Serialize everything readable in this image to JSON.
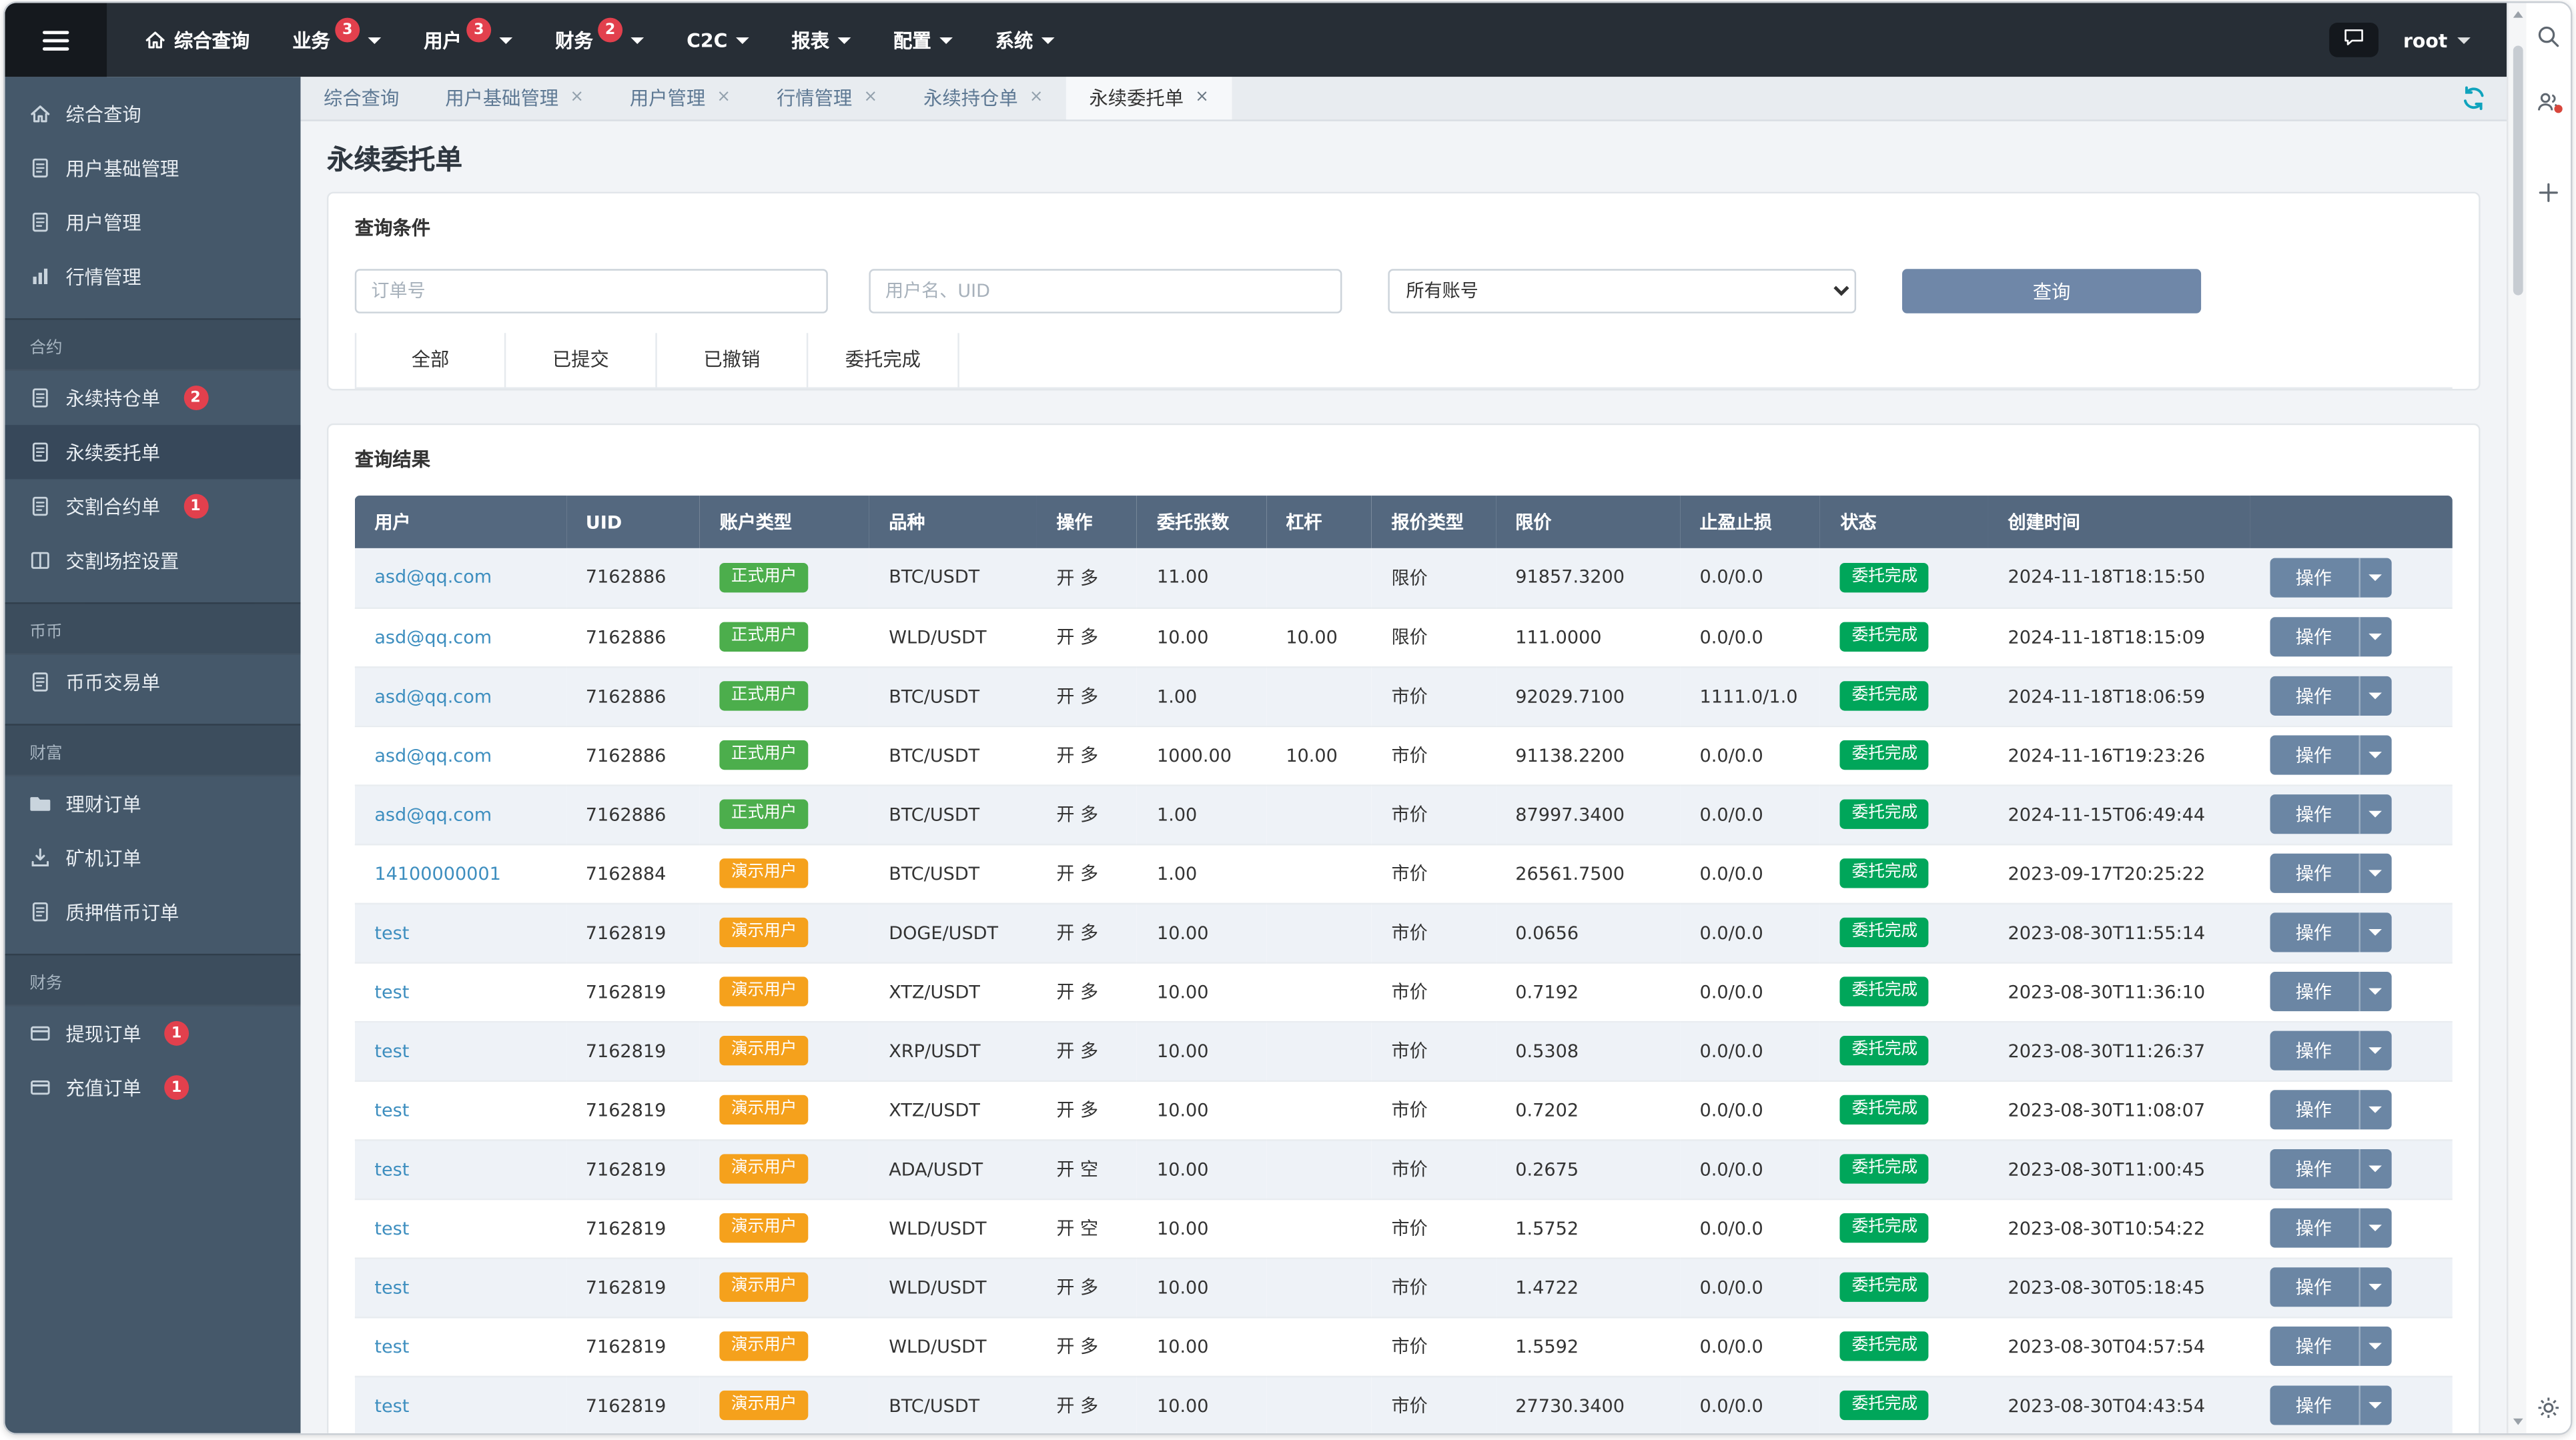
{
  "colors": {
    "navbar_bg": "#272e36",
    "sidebar_bg": "#45586a",
    "sidebar_active_bg": "#37485a",
    "accent_red_badge": "#e2404d",
    "search_button_bg": "#6f87a8",
    "table_header_bg": "#54687f",
    "account_formal_green": "#4cae4c",
    "account_demo_orange": "#f5a11c",
    "status_complete_green": "#00a65a",
    "link_blue": "#3d8ebf",
    "refresh_teal": "#0fa3bd",
    "row_stripe": "#eef2f7"
  },
  "icons": {
    "close": "×",
    "caret": "▾"
  },
  "navbar": {
    "items": [
      {
        "name": "overview",
        "label": "综合查询",
        "icon": "home",
        "badge": "",
        "caret": false
      },
      {
        "name": "business",
        "label": "业务",
        "icon": "",
        "badge": "3",
        "caret": true
      },
      {
        "name": "users",
        "label": "用户",
        "icon": "",
        "badge": "3",
        "caret": true
      },
      {
        "name": "finance",
        "label": "财务",
        "icon": "",
        "badge": "2",
        "caret": true
      },
      {
        "name": "c2c",
        "label": "C2C",
        "icon": "",
        "badge": "",
        "caret": true
      },
      {
        "name": "reports",
        "label": "报表",
        "icon": "",
        "badge": "",
        "caret": true
      },
      {
        "name": "config",
        "label": "配置",
        "icon": "",
        "badge": "",
        "caret": true
      },
      {
        "name": "system",
        "label": "系统",
        "icon": "",
        "badge": "",
        "caret": true
      }
    ],
    "user": "root"
  },
  "sidebar": {
    "sections": [
      {
        "name": "top",
        "header": "",
        "items": [
          {
            "name": "overview",
            "label": "综合查询",
            "icon": "home"
          },
          {
            "name": "user-base-management",
            "label": "用户基础管理",
            "icon": "file"
          },
          {
            "name": "user-management",
            "label": "用户管理",
            "icon": "file"
          },
          {
            "name": "market-management",
            "label": "行情管理",
            "icon": "chart"
          }
        ]
      },
      {
        "name": "contracts",
        "header": "合约",
        "items": [
          {
            "name": "perpetual-positions",
            "label": "永续持仓单",
            "icon": "file",
            "badge": "2"
          },
          {
            "name": "perpetual-orders",
            "label": "永续委托单",
            "icon": "file",
            "active": true
          },
          {
            "name": "delivery-contracts",
            "label": "交割合约单",
            "icon": "file",
            "badge": "1"
          },
          {
            "name": "delivery-risk-settings",
            "label": "交割场控设置",
            "icon": "columns"
          }
        ]
      },
      {
        "name": "spot",
        "header": "币币",
        "items": [
          {
            "name": "spot-trades",
            "label": "币币交易单",
            "icon": "file"
          }
        ]
      },
      {
        "name": "wealth",
        "header": "财富",
        "items": [
          {
            "name": "wealth-orders",
            "label": "理财订单",
            "icon": "folder"
          },
          {
            "name": "miner-orders",
            "label": "矿机订单",
            "icon": "download"
          },
          {
            "name": "pledge-loan-orders",
            "label": "质押借币订单",
            "icon": "file"
          }
        ]
      },
      {
        "name": "finance",
        "header": "财务",
        "items": [
          {
            "name": "withdraw-orders",
            "label": "提现订单",
            "icon": "card",
            "badge": "1"
          },
          {
            "name": "deposit-orders",
            "label": "充值订单",
            "icon": "card",
            "badge": "1"
          }
        ]
      }
    ]
  },
  "tabs": [
    {
      "name": "overview",
      "label": "综合查询",
      "closable": false,
      "active": false
    },
    {
      "name": "user-base-management",
      "label": "用户基础管理",
      "closable": true,
      "active": false
    },
    {
      "name": "user-management",
      "label": "用户管理",
      "closable": true,
      "active": false
    },
    {
      "name": "market-management",
      "label": "行情管理",
      "closable": true,
      "active": false
    },
    {
      "name": "perpetual-positions",
      "label": "永续持仓单",
      "closable": true,
      "active": false
    },
    {
      "name": "perpetual-orders",
      "label": "永续委托单",
      "closable": true,
      "active": true
    }
  ],
  "page": {
    "title": "永续委托单"
  },
  "query": {
    "panel_title": "查询条件",
    "order_placeholder": "订单号",
    "user_placeholder": "用户名、UID",
    "account_filter_selected": "所有账号",
    "search_button": "查询",
    "status_tabs": [
      "全部",
      "已提交",
      "已撤销",
      "委托完成"
    ],
    "status_tab_names": [
      "all",
      "submitted",
      "cancelled",
      "completed"
    ]
  },
  "results": {
    "panel_title": "查询结果",
    "columns": [
      {
        "key": "user",
        "label": "用户"
      },
      {
        "key": "uid",
        "label": "UID"
      },
      {
        "key": "account-type",
        "label": "账户类型"
      },
      {
        "key": "symbol",
        "label": "品种"
      },
      {
        "key": "side",
        "label": "操作"
      },
      {
        "key": "quantity",
        "label": "委托张数"
      },
      {
        "key": "leverage",
        "label": "杠杆"
      },
      {
        "key": "price-type",
        "label": "报价类型"
      },
      {
        "key": "limit-price",
        "label": "限价"
      },
      {
        "key": "tp-sl",
        "label": "止盈止损"
      },
      {
        "key": "status",
        "label": "状态"
      },
      {
        "key": "created",
        "label": "创建时间"
      },
      {
        "key": "actions",
        "label": ""
      }
    ],
    "action_button": "操作",
    "rows": [
      {
        "user": "asd@qq.com",
        "uid": "7162886",
        "account_type": "正式用户",
        "account_kind": "formal",
        "symbol": "BTC/USDT",
        "side": "开 多",
        "qty": "11.00",
        "leverage": "",
        "price_type": "限价",
        "price": "91857.3200",
        "tpsl": "0.0/0.0",
        "status": "委托完成",
        "created": "2024-11-18T18:15:50"
      },
      {
        "user": "asd@qq.com",
        "uid": "7162886",
        "account_type": "正式用户",
        "account_kind": "formal",
        "symbol": "WLD/USDT",
        "side": "开 多",
        "qty": "10.00",
        "leverage": "10.00",
        "price_type": "限价",
        "price": "111.0000",
        "tpsl": "0.0/0.0",
        "status": "委托完成",
        "created": "2024-11-18T18:15:09"
      },
      {
        "user": "asd@qq.com",
        "uid": "7162886",
        "account_type": "正式用户",
        "account_kind": "formal",
        "symbol": "BTC/USDT",
        "side": "开 多",
        "qty": "1.00",
        "leverage": "",
        "price_type": "市价",
        "price": "92029.7100",
        "tpsl": "1111.0/1.0",
        "status": "委托完成",
        "created": "2024-11-18T18:06:59"
      },
      {
        "user": "asd@qq.com",
        "uid": "7162886",
        "account_type": "正式用户",
        "account_kind": "formal",
        "symbol": "BTC/USDT",
        "side": "开 多",
        "qty": "1000.00",
        "leverage": "10.00",
        "price_type": "市价",
        "price": "91138.2200",
        "tpsl": "0.0/0.0",
        "status": "委托完成",
        "created": "2024-11-16T19:23:26"
      },
      {
        "user": "asd@qq.com",
        "uid": "7162886",
        "account_type": "正式用户",
        "account_kind": "formal",
        "symbol": "BTC/USDT",
        "side": "开 多",
        "qty": "1.00",
        "leverage": "",
        "price_type": "市价",
        "price": "87997.3400",
        "tpsl": "0.0/0.0",
        "status": "委托完成",
        "created": "2024-11-15T06:49:44"
      },
      {
        "user": "14100000001",
        "uid": "7162884",
        "account_type": "演示用户",
        "account_kind": "demo",
        "symbol": "BTC/USDT",
        "side": "开 多",
        "qty": "1.00",
        "leverage": "",
        "price_type": "市价",
        "price": "26561.7500",
        "tpsl": "0.0/0.0",
        "status": "委托完成",
        "created": "2023-09-17T20:25:22"
      },
      {
        "user": "test",
        "uid": "7162819",
        "account_type": "演示用户",
        "account_kind": "demo",
        "symbol": "DOGE/USDT",
        "side": "开 多",
        "qty": "10.00",
        "leverage": "",
        "price_type": "市价",
        "price": "0.0656",
        "tpsl": "0.0/0.0",
        "status": "委托完成",
        "created": "2023-08-30T11:55:14"
      },
      {
        "user": "test",
        "uid": "7162819",
        "account_type": "演示用户",
        "account_kind": "demo",
        "symbol": "XTZ/USDT",
        "side": "开 多",
        "qty": "10.00",
        "leverage": "",
        "price_type": "市价",
        "price": "0.7192",
        "tpsl": "0.0/0.0",
        "status": "委托完成",
        "created": "2023-08-30T11:36:10"
      },
      {
        "user": "test",
        "uid": "7162819",
        "account_type": "演示用户",
        "account_kind": "demo",
        "symbol": "XRP/USDT",
        "side": "开 多",
        "qty": "10.00",
        "leverage": "",
        "price_type": "市价",
        "price": "0.5308",
        "tpsl": "0.0/0.0",
        "status": "委托完成",
        "created": "2023-08-30T11:26:37"
      },
      {
        "user": "test",
        "uid": "7162819",
        "account_type": "演示用户",
        "account_kind": "demo",
        "symbol": "XTZ/USDT",
        "side": "开 多",
        "qty": "10.00",
        "leverage": "",
        "price_type": "市价",
        "price": "0.7202",
        "tpsl": "0.0/0.0",
        "status": "委托完成",
        "created": "2023-08-30T11:08:07"
      },
      {
        "user": "test",
        "uid": "7162819",
        "account_type": "演示用户",
        "account_kind": "demo",
        "symbol": "ADA/USDT",
        "side": "开 空",
        "qty": "10.00",
        "leverage": "",
        "price_type": "市价",
        "price": "0.2675",
        "tpsl": "0.0/0.0",
        "status": "委托完成",
        "created": "2023-08-30T11:00:45"
      },
      {
        "user": "test",
        "uid": "7162819",
        "account_type": "演示用户",
        "account_kind": "demo",
        "symbol": "WLD/USDT",
        "side": "开 空",
        "qty": "10.00",
        "leverage": "",
        "price_type": "市价",
        "price": "1.5752",
        "tpsl": "0.0/0.0",
        "status": "委托完成",
        "created": "2023-08-30T10:54:22"
      },
      {
        "user": "test",
        "uid": "7162819",
        "account_type": "演示用户",
        "account_kind": "demo",
        "symbol": "WLD/USDT",
        "side": "开 多",
        "qty": "10.00",
        "leverage": "",
        "price_type": "市价",
        "price": "1.4722",
        "tpsl": "0.0/0.0",
        "status": "委托完成",
        "created": "2023-08-30T05:18:45"
      },
      {
        "user": "test",
        "uid": "7162819",
        "account_type": "演示用户",
        "account_kind": "demo",
        "symbol": "WLD/USDT",
        "side": "开 多",
        "qty": "10.00",
        "leverage": "",
        "price_type": "市价",
        "price": "1.5592",
        "tpsl": "0.0/0.0",
        "status": "委托完成",
        "created": "2023-08-30T04:57:54"
      },
      {
        "user": "test",
        "uid": "7162819",
        "account_type": "演示用户",
        "account_kind": "demo",
        "symbol": "BTC/USDT",
        "side": "开 多",
        "qty": "10.00",
        "leverage": "",
        "price_type": "市价",
        "price": "27730.3400",
        "tpsl": "0.0/0.0",
        "status": "委托完成",
        "created": "2023-08-30T04:43:54"
      }
    ]
  },
  "rail": {
    "icons": [
      "search",
      "profiles",
      "plus",
      "gear"
    ]
  }
}
